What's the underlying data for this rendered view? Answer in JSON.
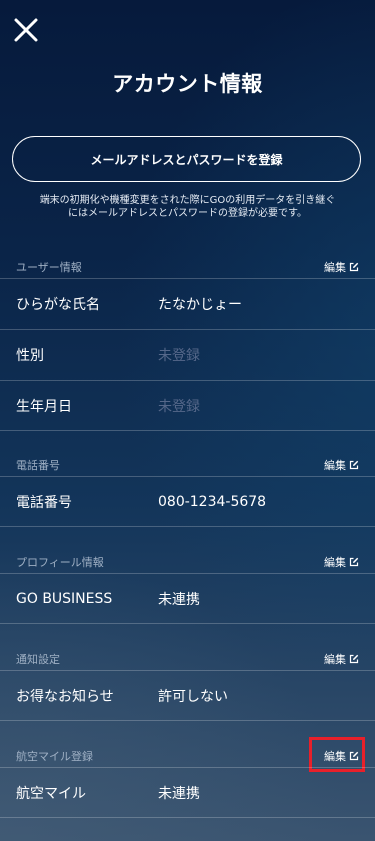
{
  "header": {
    "close_icon": "close-icon",
    "title": "アカウント情報"
  },
  "register_button": "メールアドレスとパスワードを登録",
  "notice": {
    "line1": "端末の初期化や機種変更をされた際にGOの利用データを引き継ぐ",
    "line2": "にはメールアドレスとパスワードの登録が必要です。"
  },
  "edit_label": "編集",
  "sections": {
    "user_info": {
      "title": "ユーザー情報",
      "rows": [
        {
          "label": "ひらがな氏名",
          "value": "たなかじょー"
        },
        {
          "label": "性別",
          "value": "未登録"
        },
        {
          "label": "生年月日",
          "value": "未登録"
        }
      ]
    },
    "phone": {
      "title": "電話番号",
      "rows": [
        {
          "label": "電話番号",
          "value": "080-1234-5678"
        }
      ]
    },
    "profile": {
      "title": "プロフィール情報",
      "rows": [
        {
          "label": "GO BUSINESS",
          "value": "未連携"
        }
      ]
    },
    "notifications": {
      "title": "通知設定",
      "rows": [
        {
          "label": "お得なお知らせ",
          "value": "許可しない"
        }
      ]
    },
    "mileage": {
      "title": "航空マイル登録",
      "rows": [
        {
          "label": "航空マイル",
          "value": "未連携"
        }
      ]
    }
  },
  "colors": {
    "highlight": "#e8202a",
    "unregistered_text": "#56688a",
    "section_label": "#9fb0c4"
  }
}
